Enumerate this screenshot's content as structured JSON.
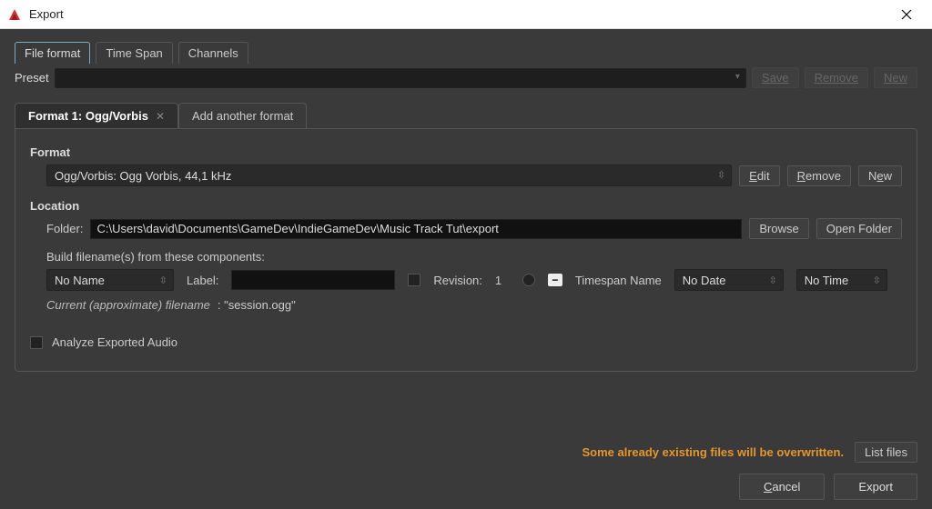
{
  "window": {
    "title": "Export"
  },
  "topTabs": {
    "t0": "File format",
    "t1": "Time Span",
    "t2": "Channels"
  },
  "preset": {
    "label": "Preset",
    "save": "Save",
    "remove": "Remove",
    "new": "New"
  },
  "formatTabs": {
    "f1": "Format 1: Ogg/Vorbis",
    "add": "Add another format"
  },
  "format": {
    "heading": "Format",
    "value": "Ogg/Vorbis: Ogg Vorbis, 44,1 kHz",
    "edit": "Edit",
    "remove": "Remove",
    "new": "New"
  },
  "location": {
    "heading": "Location",
    "folderLabel": "Folder:",
    "folderPath": "C:\\Users\\david\\Documents\\GameDev\\IndieGameDev\\Music Track Tut\\export",
    "browse": "Browse",
    "open": "Open Folder",
    "buildLabel": "Build filename(s) from these components:",
    "sessionName": "No Name",
    "labelLabel": "Label:",
    "revisionLabel": "Revision:",
    "revisionValue": "1",
    "timespanLabel": "Timespan Name",
    "dateValue": "No Date",
    "timeValue": "No Time",
    "currentPrefix": "Current (approximate) filename",
    "currentValue": ": \"session.ogg\""
  },
  "analyze": {
    "label": "Analyze Exported Audio"
  },
  "footer": {
    "warning": "Some already existing files will be overwritten.",
    "listFiles": "List files",
    "cancel": "Cancel",
    "export": "Export"
  }
}
